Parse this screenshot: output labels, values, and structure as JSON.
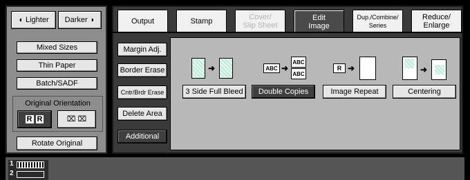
{
  "density": {
    "lighter_label": "Lighter",
    "darker_label": "Darker"
  },
  "left_panel": {
    "buttons": [
      "Mixed Sizes",
      "Thin Paper",
      "Batch/SADF"
    ],
    "orientation_label": "Original Orientation",
    "rotate_label": "Rotate Original"
  },
  "tabs": [
    {
      "label": "Output"
    },
    {
      "label": "Stamp"
    },
    {
      "label": "Cover/\nSlip Sheet"
    },
    {
      "label": "Edit\nImage"
    },
    {
      "label": "Dup./Combine/\nSeries"
    },
    {
      "label": "Reduce/\nEnlarge"
    }
  ],
  "edit_buttons": [
    "Margin Adj.",
    "Border Erase",
    "Cntr/Brdr Erase",
    "Delete Area",
    "Additional"
  ],
  "features": [
    {
      "label": "3 Side Full Bleed"
    },
    {
      "label": "Double Copies"
    },
    {
      "label": "Image Repeat"
    },
    {
      "label": "Centering"
    }
  ],
  "icon_text": {
    "abc": "ABC",
    "r": "R"
  },
  "status": {
    "line1": "1",
    "line2": "2"
  },
  "colors": {
    "active_tab": "#4a4a4a",
    "panel": "#8d8d8d",
    "selected": "#3f3f3f"
  }
}
